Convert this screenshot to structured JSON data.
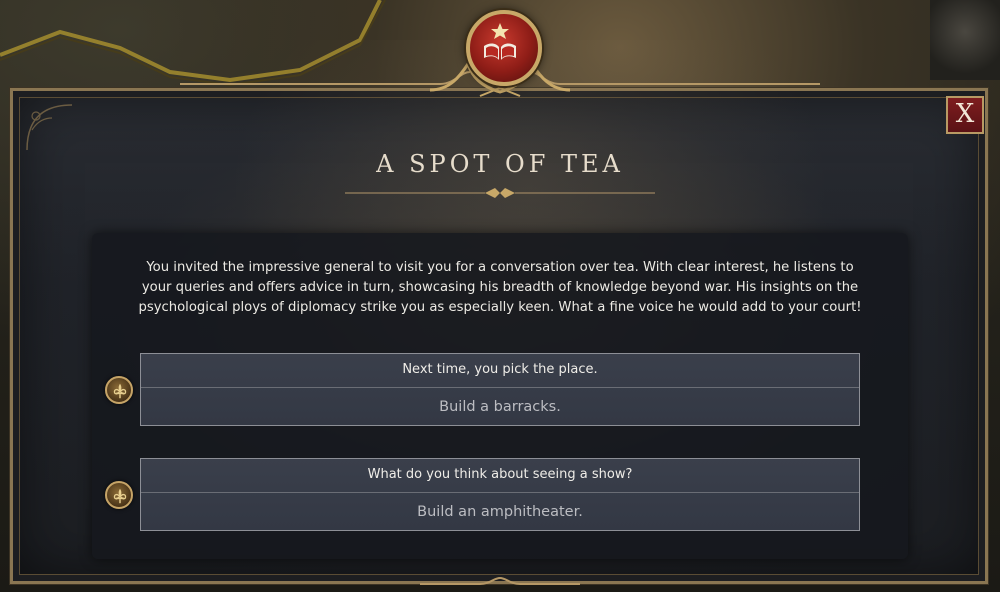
{
  "event": {
    "title": "A SPOT OF TEA",
    "description": "You invited the impressive general to visit you for a conversation over tea. With clear interest, he listens to your queries and offers advice in turn, showcasing his breadth of knowledge beyond war. His insights on the psychological ploys of diplomacy strike you as especially keen. What a fine voice he would add to your court!",
    "close_label": "X",
    "crest_icon": "book-star-icon",
    "options": [
      {
        "prompt": "Next time, you pick the place.",
        "effect": "Build a barracks.",
        "icon": "fleur-de-lis-icon"
      },
      {
        "prompt": "What do you think about seeing a show?",
        "effect": "Build an amphitheater.",
        "icon": "fleur-de-lis-icon"
      }
    ]
  },
  "colors": {
    "frame_gold": "#8a7652",
    "close_red": "#7e1d1f",
    "crest_red": "#c93a2e",
    "option_bg": "#3a3f4b",
    "title_text": "#e6dccb"
  }
}
